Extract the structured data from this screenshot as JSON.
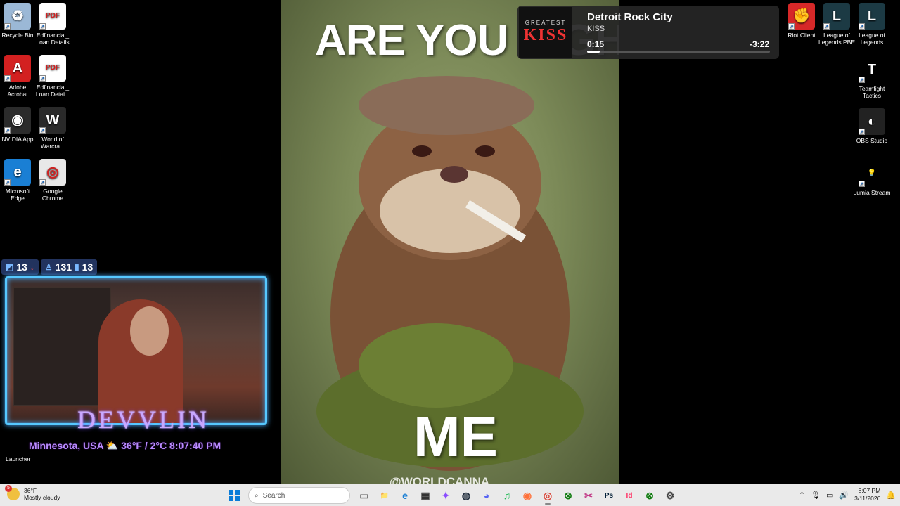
{
  "desktop_left": [
    {
      "label": "Recycle Bin",
      "icon": "recycle-bin-icon",
      "color": "#9bb8d6",
      "glyph": "♻"
    },
    {
      "label": "Edfinancial_ Loan Details",
      "icon": "pdf-icon",
      "color": "#ffffff",
      "glyph": "PDF"
    },
    {
      "label": "Adobe Acrobat",
      "icon": "adobe-acrobat-icon",
      "color": "#d32020",
      "glyph": "A"
    },
    {
      "label": "Edfinancial_ Loan Detai...",
      "icon": "pdf-icon",
      "color": "#ffffff",
      "glyph": "PDF"
    },
    {
      "label": "NVIDIA App",
      "icon": "nvidia-icon",
      "color": "#2b2b2b",
      "glyph": "◉"
    },
    {
      "label": "World of Warcra...",
      "icon": "wow-icon",
      "color": "#2a2a2a",
      "glyph": "W"
    },
    {
      "label": "Microsoft Edge",
      "icon": "edge-icon",
      "color": "#1a7fd4",
      "glyph": "e"
    },
    {
      "label": "Google Chrome",
      "icon": "chrome-icon",
      "color": "#e8e8e8",
      "glyph": "◎"
    }
  ],
  "desktop_right": [
    {
      "label": "Riot Client",
      "icon": "riot-client-icon",
      "color": "#d62828",
      "glyph": "✊"
    },
    {
      "label": "League of Legends PBE",
      "icon": "league-pbe-icon",
      "color": "#1c3a44",
      "glyph": "L"
    },
    {
      "label": "League of Legends",
      "icon": "league-icon",
      "color": "#1c3a44",
      "glyph": "L"
    },
    {
      "label": "Teamfight Tactics",
      "icon": "tft-icon",
      "color": "#000000",
      "glyph": "T"
    },
    {
      "label": "OBS Studio",
      "icon": "obs-icon",
      "color": "#222222",
      "glyph": "◐"
    },
    {
      "label": "Lumia Stream",
      "icon": "lumia-icon",
      "color": "#000000",
      "glyph": "💡"
    }
  ],
  "meme": {
    "top_text": "ARE YOU HIGH?",
    "bottom_text": "ME",
    "credit": "@WORLDCANNA"
  },
  "media": {
    "album_top": "GREATEST",
    "album_band": "KISS",
    "title": "Detroit Rock City",
    "artist": "KISS",
    "elapsed": "0:15",
    "remaining": "-3:22",
    "progress": 0.07
  },
  "stats": {
    "followers": "13",
    "viewers": "131",
    "chatters": "13"
  },
  "webcam": {
    "name": "DEVVLIN"
  },
  "weather_line": "Minnesota, USA  ⛅  36°F / 2°C  8:07:40 PM",
  "launcher_label": "Launcher",
  "taskbar": {
    "weather_temp": "36°F",
    "weather_desc": "Mostly cloudy",
    "weather_badge": "5",
    "search_placeholder": "Search",
    "time": "8:07 PM",
    "date": "3/11/2026",
    "apps": [
      {
        "name": "task-view-icon",
        "glyph": "▭",
        "color": "#555"
      },
      {
        "name": "file-explorer-icon",
        "glyph": "📁",
        "color": "#e0a800"
      },
      {
        "name": "edge-taskbar-icon",
        "glyph": "e",
        "color": "#1a7fd4"
      },
      {
        "name": "store-icon",
        "glyph": "▦",
        "color": "#333"
      },
      {
        "name": "copilot-icon",
        "glyph": "✦",
        "color": "#8a4cff"
      },
      {
        "name": "steam-icon",
        "glyph": "◍",
        "color": "#1b2838"
      },
      {
        "name": "discord-icon",
        "glyph": "◕",
        "color": "#5865f2"
      },
      {
        "name": "spotify-icon",
        "glyph": "♫",
        "color": "#1db954"
      },
      {
        "name": "firefox-icon",
        "glyph": "◉",
        "color": "#ff7139"
      },
      {
        "name": "chrome-taskbar-icon",
        "glyph": "◎",
        "color": "#db4437"
      },
      {
        "name": "xbox-icon",
        "glyph": "⊗",
        "color": "#107c10"
      },
      {
        "name": "snipping-icon",
        "glyph": "✂",
        "color": "#c13584"
      },
      {
        "name": "photoshop-icon",
        "glyph": "Ps",
        "color": "#001e36"
      },
      {
        "name": "indesign-icon",
        "glyph": "Id",
        "color": "#ff3366"
      },
      {
        "name": "xbox-game-bar-icon",
        "glyph": "⊗",
        "color": "#107c10"
      },
      {
        "name": "settings-icon",
        "glyph": "⚙",
        "color": "#444"
      }
    ]
  }
}
